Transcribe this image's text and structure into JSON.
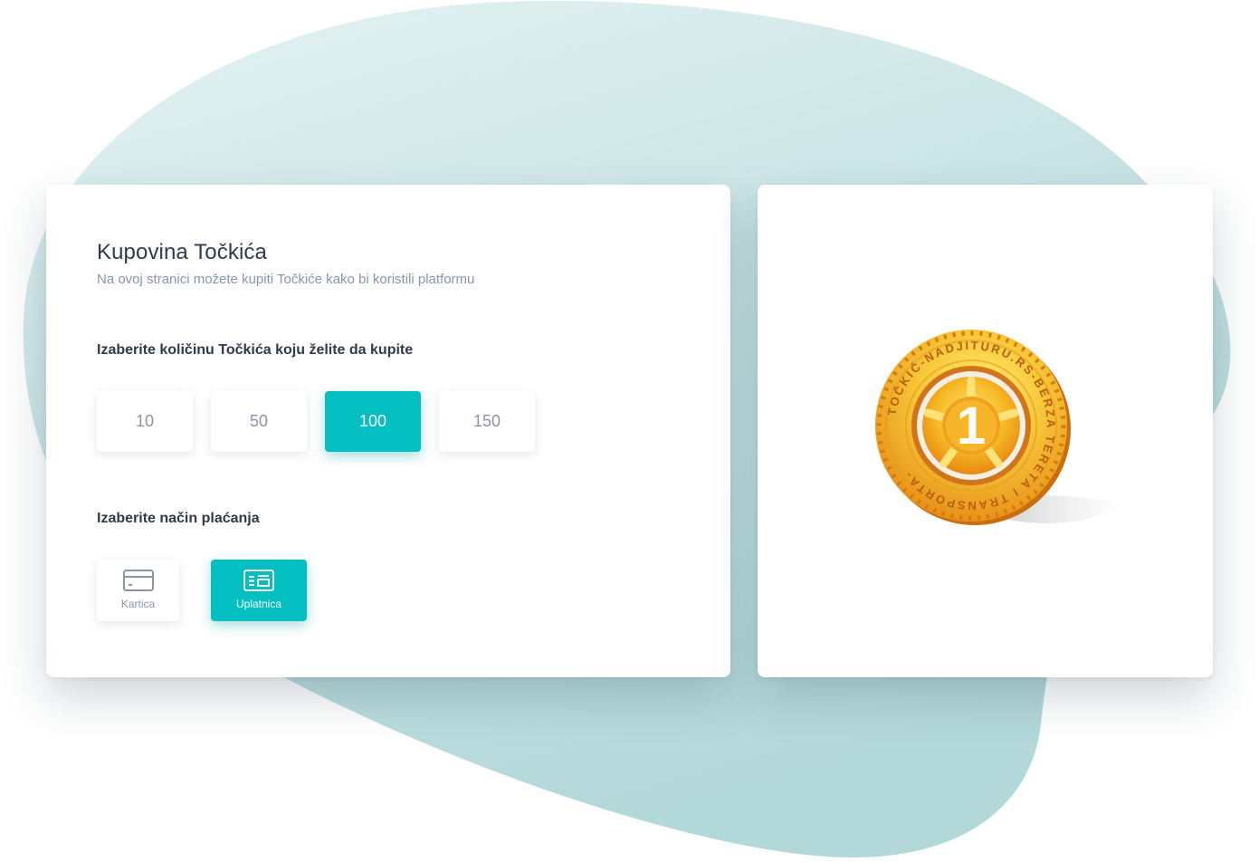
{
  "page": {
    "title": "Kupovina Točkića",
    "subtitle": "Na ovoj stranici možete kupiti Točkiće kako bi koristili platformu"
  },
  "amount_section": {
    "label": "Izaberite količinu Točkića koju želite da kupite",
    "options": [
      "10",
      "50",
      "100",
      "150"
    ],
    "selected": "100"
  },
  "payment_section": {
    "label": "Izaberite način plaćanja",
    "options": [
      {
        "label": "Kartica",
        "icon": "credit-card-icon"
      },
      {
        "label": "Uplatnica",
        "icon": "payment-slip-icon"
      }
    ],
    "selected": "Uplatnica"
  },
  "coin": {
    "number": "1",
    "ring_text": "TOČKIĆ-NADJITURU.RS-BERZA TERETA I TRANSPORTA-"
  },
  "colors": {
    "accent": "#04bfc1",
    "title_text": "#2f3a4e",
    "muted_text": "#8a95a8",
    "blob": "#c9e4e5",
    "coin_gold": "#f5b520",
    "coin_orange": "#e07d12"
  }
}
